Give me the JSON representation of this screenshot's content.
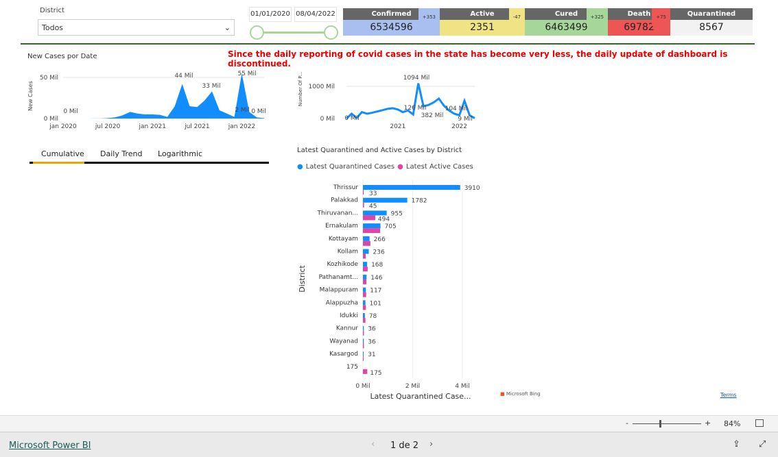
{
  "filters": {
    "district_label": "District",
    "district_value": "Todos",
    "start_date": "01/01/2020",
    "end_date": "08/04/2022"
  },
  "kpis": [
    {
      "label": "Confirmed",
      "value": "6534596",
      "delta": "+353",
      "color": "#a9bff0"
    },
    {
      "label": "Active",
      "value": "2351",
      "delta": "-47",
      "color": "#f0e384"
    },
    {
      "label": "Cured",
      "value": "6463499",
      "delta": "+325",
      "color": "#a6d69a"
    },
    {
      "label": "Death",
      "value": "69782",
      "delta": "+75",
      "color": "#ee5555"
    },
    {
      "label": "Quarantined",
      "value": "8567",
      "delta": "",
      "color": "#f2f2f2"
    }
  ],
  "notice": "Since the daily reporting of covid cases in the state has become very less, the daily update of dashboard is discontinued.",
  "tabs": [
    "Cumulative",
    "Daily Trend",
    "Logarithmic"
  ],
  "chart_data": [
    {
      "type": "area",
      "title": "New Cases por Date",
      "ylabel": "New Cases",
      "ylim": [
        0,
        55
      ],
      "yticks": [
        "0 Mil",
        "50 Mil"
      ],
      "xticks": [
        "jan 2020",
        "jul 2020",
        "jan 2021",
        "jul 2021",
        "jan 2022"
      ],
      "x": [
        "2020-01",
        "2020-02",
        "2020-03",
        "2020-04",
        "2020-05",
        "2020-06",
        "2020-07",
        "2020-08",
        "2020-09",
        "2020-10",
        "2020-11",
        "2020-12",
        "2021-01",
        "2021-02",
        "2021-03",
        "2021-04",
        "2021-05",
        "2021-06",
        "2021-07",
        "2021-08",
        "2021-09",
        "2021-10",
        "2021-11",
        "2021-12",
        "2022-01",
        "2022-02",
        "2022-03",
        "2022-04"
      ],
      "values": [
        0,
        0,
        0,
        0,
        0.1,
        0.1,
        0.5,
        1.5,
        4,
        8,
        6,
        5,
        5,
        4.5,
        2,
        15,
        42,
        15,
        14,
        22,
        33,
        10,
        6,
        2,
        55,
        8,
        1.5,
        0.5
      ],
      "annotations": [
        "0 Mil",
        "44 Mil",
        "33 Mil",
        "2 Mil",
        "55 Mil",
        "0 Mil"
      ],
      "color": "#118dff"
    },
    {
      "type": "line",
      "ylabel": "Number Of P...",
      "ylim": [
        0,
        1100
      ],
      "yticks": [
        "0 Mil",
        "1000 Mil"
      ],
      "xticks": [
        "2021",
        "2022"
      ],
      "x": [
        "2020-03",
        "2020-04",
        "2020-05",
        "2020-06",
        "2020-07",
        "2020-08",
        "2020-09",
        "2020-10",
        "2020-11",
        "2020-12",
        "2021-01",
        "2021-02",
        "2021-03",
        "2021-04",
        "2021-05",
        "2021-06",
        "2021-07",
        "2021-08",
        "2021-09",
        "2021-10",
        "2021-11",
        "2021-12",
        "2022-01",
        "2022-02",
        "2022-03",
        "2022-04"
      ],
      "values": [
        0,
        150,
        20,
        200,
        150,
        180,
        220,
        260,
        300,
        320,
        280,
        200,
        250,
        126,
        1094,
        382,
        420,
        500,
        620,
        400,
        250,
        150,
        104,
        550,
        100,
        9
      ],
      "annotations": [
        "0 Mil",
        "126 Mil",
        "1094 Mil",
        "382 Mil",
        "104 Mil",
        "9 Mil"
      ],
      "color": "#118dff"
    },
    {
      "type": "bar",
      "title": "Latest Quarantined and Active Cases by District",
      "xlabel": "Latest Quarantined Case...",
      "ylabel": "District",
      "xlim": [
        0,
        4
      ],
      "xticks": [
        "0 Mil",
        "2 Mil",
        "4 Mil"
      ],
      "categories": [
        "Thrissur",
        "Palakkad",
        "Thiruvanan...",
        "Ernakulam",
        "Kottayam",
        "Kollam",
        "Kozhikode",
        "Pathanamt...",
        "Malappuram",
        "Alappuzha",
        "Idukki",
        "Kannur",
        "Wayanad",
        "Kasargod",
        "175"
      ],
      "series": [
        {
          "name": "Latest Quarantined Cases",
          "color": "#118dff",
          "values": [
            3910,
            1782,
            955,
            705,
            266,
            236,
            168,
            146,
            117,
            101,
            78,
            36,
            36,
            31,
            null
          ],
          "labels": [
            "3910",
            "1782",
            "955",
            "705",
            "266",
            "236",
            "168",
            "146",
            "117",
            "101",
            "78",
            "36",
            "36",
            "31",
            ""
          ]
        },
        {
          "name": "Latest Active Cases",
          "color": "#e044a7",
          "values": [
            33,
            45,
            494,
            690,
            300,
            110,
            190,
            140,
            130,
            120,
            100,
            40,
            40,
            10,
            175
          ],
          "labels": [
            "33",
            "45",
            "494",
            "",
            "",
            "",
            "",
            "",
            "",
            "",
            "",
            "",
            "",
            "",
            "175"
          ]
        }
      ],
      "legend": "top-left"
    }
  ],
  "bing": "Microsoft Bing",
  "terms": "Terms",
  "zoom": {
    "level": "84%",
    "minus": "-",
    "plus": "+"
  },
  "footer": {
    "brand": "Microsoft Power BI",
    "page": "1 de 2"
  }
}
